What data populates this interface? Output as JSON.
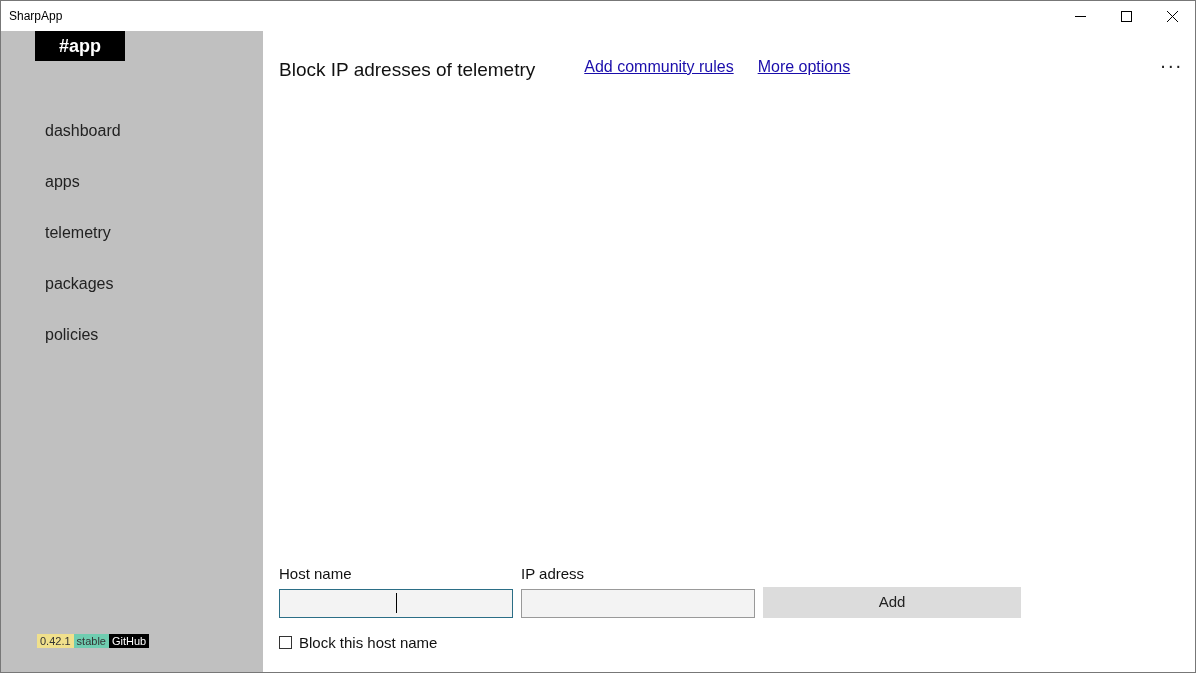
{
  "window": {
    "title": "SharpApp"
  },
  "sidebar": {
    "logo": "#app",
    "items": [
      {
        "label": "dashboard"
      },
      {
        "label": "apps"
      },
      {
        "label": "telemetry"
      },
      {
        "label": "packages"
      },
      {
        "label": "policies"
      }
    ],
    "badges": [
      {
        "label": "0.42.1",
        "color": "#f0e08c"
      },
      {
        "label": "stable",
        "color": "#6fcdb0"
      },
      {
        "label": "GitHub",
        "color": "#000000"
      }
    ]
  },
  "header": {
    "title": "Block IP adresses of telemetry",
    "links": [
      "Add community rules",
      "More options"
    ],
    "more": "..."
  },
  "form": {
    "fields": [
      {
        "label": "Host name",
        "focused": true
      },
      {
        "label": "IP adress",
        "focused": false
      }
    ],
    "button": "Add",
    "checkbox": {
      "label": "Block this host name",
      "checked": false
    }
  }
}
